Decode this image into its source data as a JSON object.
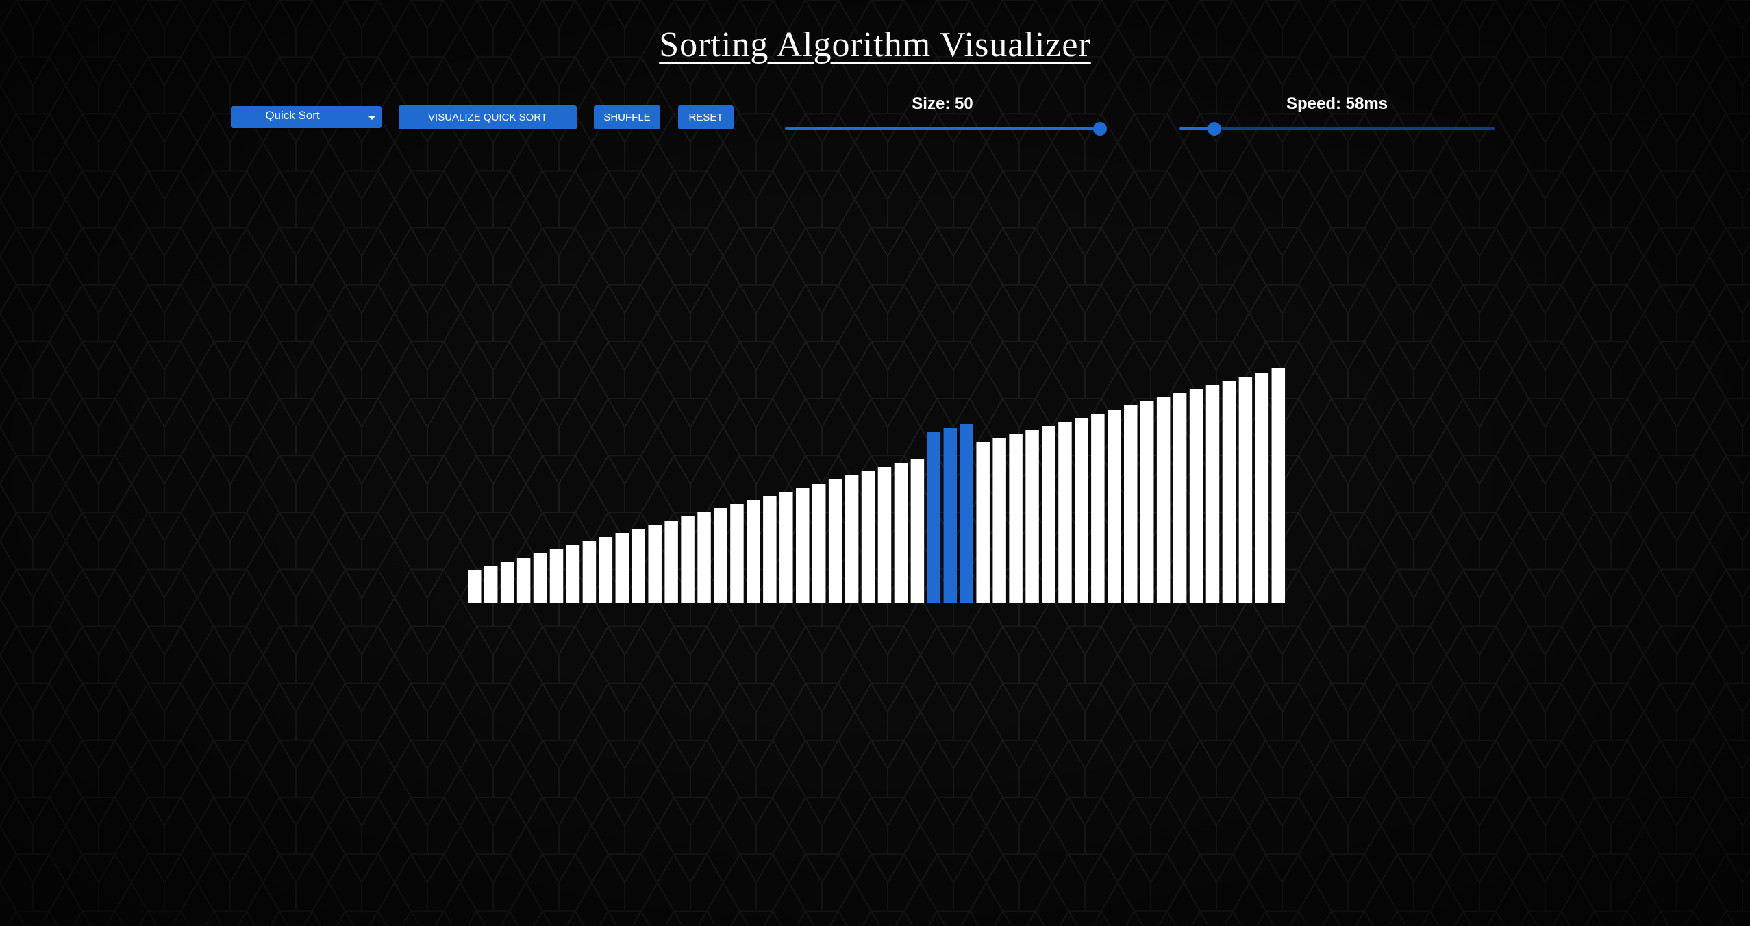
{
  "title": "Sorting Algorithm Visualizer",
  "controls": {
    "algorithm_select": "Quick Sort",
    "visualize_label": "VISUALIZE QUICK SORT",
    "shuffle_label": "SHUFFLE",
    "reset_label": "RESET",
    "size_label": "Size: 50",
    "speed_label": "Speed: 58ms",
    "size_fraction": 1.0,
    "speed_fraction": 0.11
  },
  "colors": {
    "accent": "#1f6bd1",
    "bar": "#ffffff",
    "bar_highlight": "#1f6bd1",
    "background": "#0a0a0a"
  },
  "bars": {
    "count": 50,
    "values": [
      49,
      55,
      61,
      67,
      73,
      79,
      85,
      91,
      97,
      103,
      109,
      115,
      121,
      127,
      133,
      139,
      145,
      151,
      157,
      163,
      169,
      175,
      181,
      187,
      193,
      199,
      205,
      211,
      250,
      256,
      262,
      235,
      241,
      247,
      253,
      259,
      265,
      271,
      277,
      283,
      289,
      295,
      301,
      307,
      313,
      319,
      325,
      331,
      337,
      343
    ],
    "highlighted": [
      28,
      29,
      30
    ]
  }
}
